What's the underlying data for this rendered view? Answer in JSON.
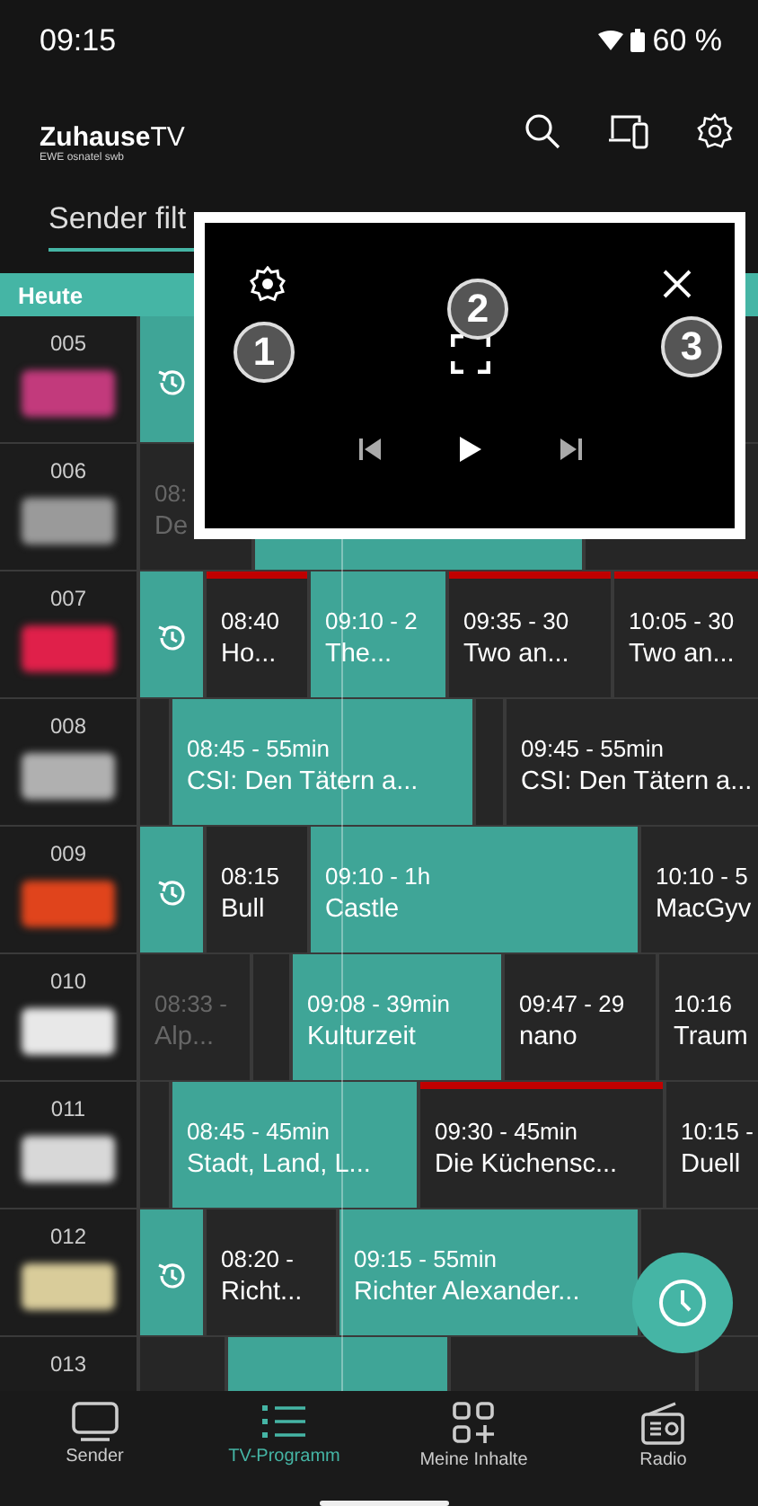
{
  "status_bar": {
    "time": "09:15",
    "battery": "60 %"
  },
  "header": {
    "logo": "**Zuhause**TV",
    "logo_subtitle": "EWE osnatel swb"
  },
  "filter": {
    "label": "Sender filt"
  },
  "day": "Heute",
  "channels": [
    {
      "number": "005",
      "color": "#c23a7c",
      "programs": [
        {
          "kind": "replay"
        },
        {
          "kind": "program",
          "current": false
        }
      ]
    },
    {
      "number": "006",
      "color": "#9a9a9a",
      "programs": [
        {
          "kind": "program",
          "past": true,
          "time": "08:",
          "title": "De"
        },
        {
          "kind": "program",
          "current": true
        },
        {
          "kind": "program",
          "current": false
        }
      ]
    },
    {
      "number": "007",
      "color": "#e0204a",
      "programs": [
        {
          "kind": "replay"
        },
        {
          "kind": "program",
          "marked": true,
          "time": "08:40",
          "title": "Ho..."
        },
        {
          "kind": "program",
          "current": true,
          "time": "09:10 - 2",
          "title": "The..."
        },
        {
          "kind": "program",
          "marked": true,
          "time": "09:35 - 30",
          "title": "Two an..."
        },
        {
          "kind": "program",
          "marked": true,
          "time": "10:05 - 30",
          "title": "Two an..."
        }
      ]
    },
    {
      "number": "008",
      "color": "#b0b0b0",
      "programs": [
        {
          "kind": "program"
        },
        {
          "kind": "program",
          "current": true,
          "time": "08:45 - 55min",
          "title": "CSI: Den Tätern a..."
        },
        {
          "kind": "program"
        },
        {
          "kind": "program",
          "time": "09:45 - 55min",
          "title": "CSI: Den Tätern a..."
        }
      ]
    },
    {
      "number": "009",
      "color": "#e0441c",
      "programs": [
        {
          "kind": "replay"
        },
        {
          "kind": "program",
          "time": "08:15",
          "title": "Bull"
        },
        {
          "kind": "program",
          "current": true,
          "time": "09:10 - 1h",
          "title": "Castle"
        },
        {
          "kind": "program",
          "time": "10:10 - 5",
          "title": "MacGyv"
        }
      ]
    },
    {
      "number": "010",
      "color": "#e8e8e8",
      "programs": [
        {
          "kind": "program",
          "past": true,
          "time": "08:33 -",
          "title": "Alp..."
        },
        {
          "kind": "program"
        },
        {
          "kind": "program",
          "current": true,
          "time": "09:08 - 39min",
          "title": "Kulturzeit"
        },
        {
          "kind": "program",
          "time": "09:47 - 29",
          "title": "nano"
        },
        {
          "kind": "program",
          "time": "10:16",
          "title": "Traum"
        }
      ]
    },
    {
      "number": "011",
      "color": "#d8d8d8",
      "programs": [
        {
          "kind": "program"
        },
        {
          "kind": "program",
          "current": true,
          "time": "08:45 - 45min",
          "title": "Stadt, Land, L..."
        },
        {
          "kind": "program",
          "marked": true,
          "time": "09:30 - 45min",
          "title": "Die Küchensc..."
        },
        {
          "kind": "program",
          "time": "10:15 -",
          "title": "Duell"
        }
      ]
    },
    {
      "number": "012",
      "color": "#d9cc9a",
      "programs": [
        {
          "kind": "replay"
        },
        {
          "kind": "program",
          "time": "08:20 -",
          "title": "Richt..."
        },
        {
          "kind": "program",
          "current": true,
          "time": "09:15 - 55min",
          "title": "Richter Alexander..."
        },
        {
          "kind": "program"
        }
      ]
    },
    {
      "number": "013",
      "programs": [
        {
          "kind": "program"
        },
        {
          "kind": "program",
          "current": true
        },
        {
          "kind": "program"
        },
        {
          "kind": "program"
        }
      ]
    }
  ],
  "player": {
    "callouts": [
      "1",
      "2",
      "3"
    ]
  },
  "nav": [
    {
      "label": "Sender",
      "selected": false
    },
    {
      "label": "TV-Programm",
      "selected": true
    },
    {
      "label": "Meine Inhalte",
      "selected": false
    },
    {
      "label": "Radio",
      "selected": false
    }
  ]
}
